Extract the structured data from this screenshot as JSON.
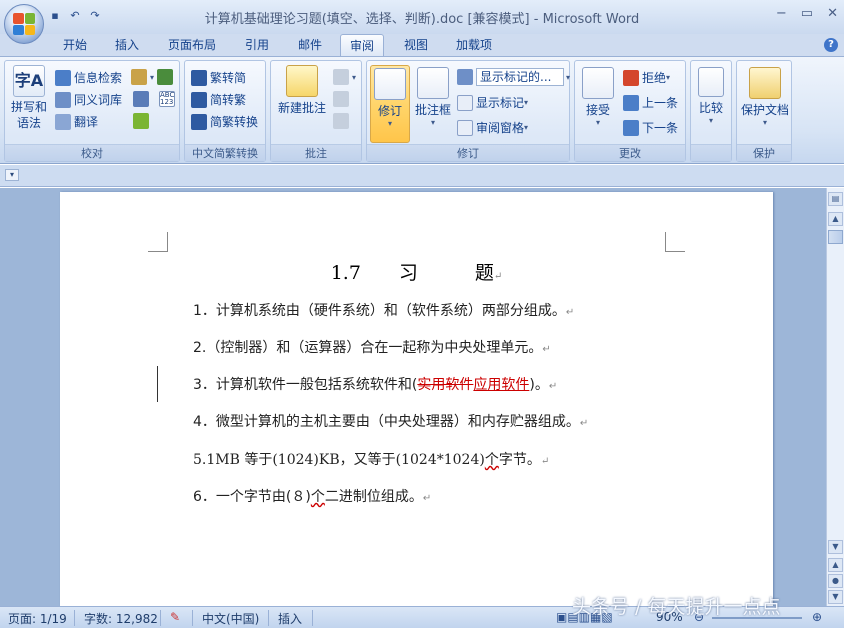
{
  "window": {
    "title": "计算机基础理论习题(填空、选择、判断).doc [兼容模式] - Microsoft Word",
    "controls": [
      "−",
      "▭",
      "✕"
    ]
  },
  "tabs": [
    "开始",
    "插入",
    "页面布局",
    "引用",
    "邮件",
    "审阅",
    "视图",
    "加载项"
  ],
  "active_tab": "审阅",
  "ribbon": {
    "proofing": {
      "label": "校对",
      "spelling": "拼写和\n语法",
      "research": "信息检索",
      "thesaurus": "同义词库",
      "translate": "翻译"
    },
    "chinese_convert": {
      "label": "中文简繁转换",
      "to_simplified": "繁转简",
      "to_traditional": "简转繁",
      "convert": "简繁转换"
    },
    "comments": {
      "label": "批注",
      "new_comment": "新建批注"
    },
    "tracking": {
      "label": "修订",
      "track_changes": "修订",
      "balloons": "批注框",
      "display_for_review": "显示标记的...",
      "show_markup": "显示标记",
      "reviewing_pane": "审阅窗格"
    },
    "changes": {
      "label": "更改",
      "accept": "接受",
      "reject": "拒绝",
      "previous": "上一条",
      "next": "下一条"
    },
    "compare": {
      "label": "",
      "compare": "比较"
    },
    "protect": {
      "label": "保护",
      "protect_doc": "保护文档"
    }
  },
  "document": {
    "heading": "1.7　　习　　　题",
    "lines": [
      "1．计算机系统由（硬件系统）和（软件系统）两部分组成。",
      "2.（控制器）和（运算器）合在一起称为中央处理单元。",
      "3．计算机软件一般包括系统软件和(",
      "实用软件",
      "应用软件",
      ")。",
      "4．微型计算机的主机主要由（中央处理器）和内存贮器组成。",
      "5.1MB 等于(1024)KB，又等于(1024*1024)",
      "个",
      "字节。",
      "6．一个字节由(８)",
      "个",
      "二进制位组成。"
    ]
  },
  "status": {
    "page": "页面: 1/19",
    "words": "字数: 12,982",
    "language": "中文(中国)",
    "mode": "插入",
    "zoom": "90%"
  },
  "watermark": "头条号 / 每天提升一点点",
  "colors": {
    "accent": "#15428b",
    "track_red": "#cc0000"
  }
}
